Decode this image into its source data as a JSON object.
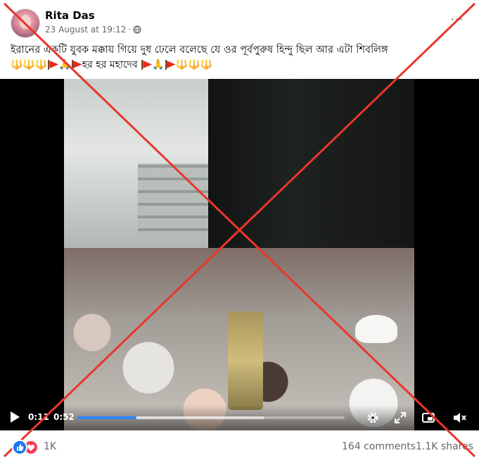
{
  "post": {
    "author": "Rita Das",
    "timestamp": "23 August at 19:12",
    "separator": "·",
    "privacy_icon": "globe-icon",
    "caption": "ইরানের একটি যুবক মক্কায় গিয়ে দুধ ঢেলে বলেছে যে ওর পূর্বপুরুষ হিন্দু ছিল আর এটা শিবলিঙ্গ",
    "hashtag_line_text": "হর হর মহাদেব"
  },
  "video": {
    "current_time": "0:11",
    "duration": "0:52",
    "progress_fraction": 0.22,
    "buffered_fraction": 0.7,
    "progress_color": "#2d88ff",
    "icons": [
      "play-icon",
      "gear-icon",
      "expand-icon",
      "pip-icon",
      "volume-muted-icon"
    ]
  },
  "overlay": {
    "cross_color": "#e8372b"
  },
  "footer": {
    "reaction_count": "1K",
    "comments": "164 comments",
    "shares": "1.1K shares",
    "reaction_icons": [
      "like-icon",
      "love-icon"
    ]
  }
}
